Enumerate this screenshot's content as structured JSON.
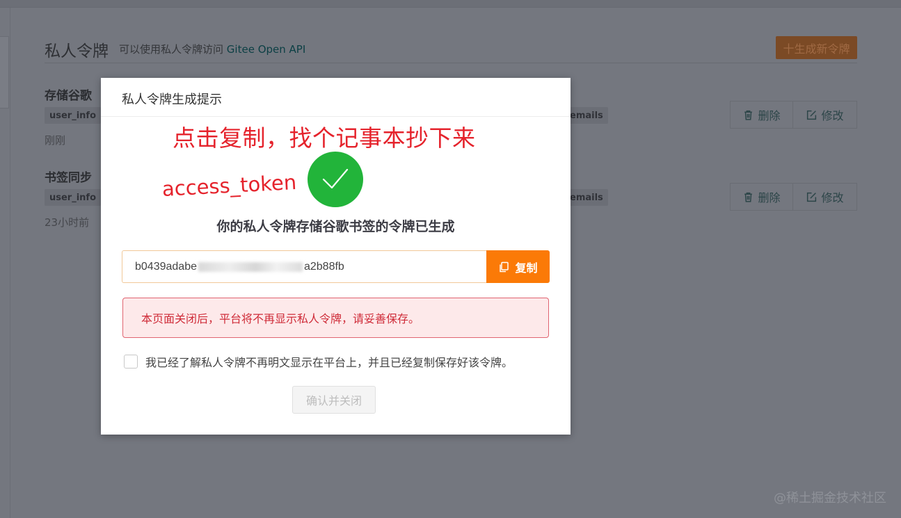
{
  "background": {
    "title": "私人令牌",
    "subtitle_prefix": "可以使用私人令牌访问",
    "subtitle_link": "Gitee Open API",
    "new_token_button": "十生成新令牌",
    "tokens": [
      {
        "name": "存储谷歌",
        "tags": [
          "user_info",
          "emails"
        ],
        "time": "刚刚",
        "delete_label": "删除",
        "edit_label": "修改"
      },
      {
        "name": "书签同步",
        "tags": [
          "user_info",
          "emails"
        ],
        "time": "23小时前",
        "delete_label": "删除",
        "edit_label": "修改"
      }
    ]
  },
  "modal": {
    "title": "私人令牌生成提示",
    "annotation_copy": "点击复制，找个记事本抄下来",
    "annotation_token": "access_token",
    "success_text": "你的私人令牌存储谷歌书签的令牌已生成",
    "token_prefix": "b0439adabe",
    "token_suffix": "a2b88fb",
    "copy_button": "复制",
    "warning": "本页面关闭后，平台将不再显示私人令牌，请妥善保存。",
    "agree_text": "我已经了解私人令牌不再明文显示在平台上，并且已经复制保存好该令牌。",
    "agree_checked": false,
    "confirm_button": "确认并关闭"
  },
  "watermark": "@稀土掘金技术社区",
  "colors": {
    "accent_orange": "#fb7a07",
    "success_green": "#22b43a",
    "warning_red": "#cf2b38",
    "annotation_red": "#e5232c",
    "overlay": "#74777f"
  }
}
